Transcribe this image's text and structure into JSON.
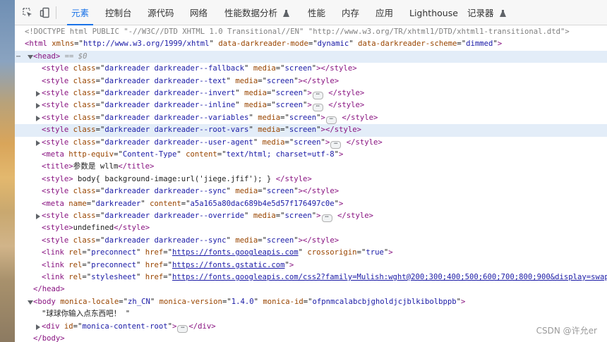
{
  "tabs": [
    "元素",
    "控制台",
    "源代码",
    "网络",
    "性能数据分析",
    "性能",
    "内存",
    "应用",
    "Lighthouse",
    "记录器"
  ],
  "doctype": "<!DOCTYPE html PUBLIC \"-//W3C//DTD XHTML 1.0 Transitional//EN\" \"http://www.w3.org/TR/xhtml1/DTD/xhtml1-transitional.dtd\">",
  "html_open": {
    "tag": "html",
    "attrs": [
      [
        "xmlns",
        "http://www.w3.org/1999/xhtml"
      ],
      [
        "data-darkreader-mode",
        "dynamic"
      ],
      [
        "data-darkreader-scheme",
        "dimmed"
      ]
    ]
  },
  "head_open": {
    "tag": "head",
    "selected_marker": "== $0"
  },
  "head_children": [
    {
      "tag": "style",
      "attrs": [
        [
          "class",
          "darkreader darkreader--fallback"
        ],
        [
          "media",
          "screen"
        ]
      ],
      "collapsed": false
    },
    {
      "tag": "style",
      "attrs": [
        [
          "class",
          "darkreader darkreader--text"
        ],
        [
          "media",
          "screen"
        ]
      ],
      "collapsed": false
    },
    {
      "tag": "style",
      "attrs": [
        [
          "class",
          "darkreader darkreader--invert"
        ],
        [
          "media",
          "screen"
        ]
      ],
      "collapsed": true
    },
    {
      "tag": "style",
      "attrs": [
        [
          "class",
          "darkreader darkreader--inline"
        ],
        [
          "media",
          "screen"
        ]
      ],
      "collapsed": true
    },
    {
      "tag": "style",
      "attrs": [
        [
          "class",
          "darkreader darkreader--variables"
        ],
        [
          "media",
          "screen"
        ]
      ],
      "collapsed": true
    },
    {
      "tag": "style",
      "attrs": [
        [
          "class",
          "darkreader darkreader--root-vars"
        ],
        [
          "media",
          "screen"
        ]
      ],
      "collapsed": false,
      "hover": true
    },
    {
      "tag": "style",
      "attrs": [
        [
          "class",
          "darkreader darkreader--user-agent"
        ],
        [
          "media",
          "screen"
        ]
      ],
      "collapsed": true
    },
    {
      "tag": "meta",
      "attrs": [
        [
          "http-equiv",
          "Content-Type"
        ],
        [
          "content",
          "text/html; charset=utf-8"
        ]
      ],
      "void": true
    },
    {
      "tag": "title",
      "text": "参数是 wllm"
    },
    {
      "tag": "style",
      "text": " body{ background-image:url('jiege.jfif'); } "
    },
    {
      "tag": "style",
      "attrs": [
        [
          "class",
          "darkreader darkreader--sync"
        ],
        [
          "media",
          "screen"
        ]
      ],
      "collapsed": false
    },
    {
      "tag": "meta",
      "attrs": [
        [
          "name",
          "darkreader"
        ],
        [
          "content",
          "a5a165a80dac689b4e5d57f176497c0e"
        ]
      ],
      "void": true
    },
    {
      "tag": "style",
      "attrs": [
        [
          "class",
          "darkreader darkreader--override"
        ],
        [
          "media",
          "screen"
        ]
      ],
      "collapsed": true
    },
    {
      "tag": "style",
      "text": "undefined"
    },
    {
      "tag": "style",
      "attrs": [
        [
          "class",
          "darkreader darkreader--sync"
        ],
        [
          "media",
          "screen"
        ]
      ],
      "collapsed": false
    },
    {
      "tag": "link",
      "attrs": [
        [
          "rel",
          "preconnect"
        ],
        [
          "href",
          "https://fonts.googleapis.com"
        ],
        [
          "crossorigin",
          "true"
        ]
      ],
      "link": true,
      "void": true
    },
    {
      "tag": "link",
      "attrs": [
        [
          "rel",
          "preconnect"
        ],
        [
          "href",
          "https://fonts.gstatic.com"
        ]
      ],
      "link": true,
      "void": true
    },
    {
      "tag": "link",
      "attrs": [
        [
          "rel",
          "stylesheet"
        ],
        [
          "href",
          "https://fonts.googleapis.com/css2?family=Mulish:wght@200;300;400;500;600;700;800;900&display=swap"
        ]
      ],
      "link": true,
      "void": true
    }
  ],
  "head_close": "head",
  "body_open": {
    "tag": "body",
    "attrs": [
      [
        "monica-locale",
        "zh_CN"
      ],
      [
        "monica-version",
        "1.4.0"
      ],
      [
        "monica-id",
        "ofpnmcalabcbjgholdjcjblkibolbppb"
      ]
    ]
  },
  "body_text": "\"球球你输入点东西吧！ \"",
  "body_div": {
    "tag": "div",
    "attrs": [
      [
        "id",
        "monica-content-root"
      ]
    ],
    "collapsed": true
  },
  "body_close": "body",
  "watermark": "CSDN @许允er",
  "colors": {
    "accent": "#1a73e8",
    "tag": "#881280",
    "attr_name": "#994500",
    "attr_value": "#1a1aa6",
    "selected_row": "#e3edf8"
  }
}
